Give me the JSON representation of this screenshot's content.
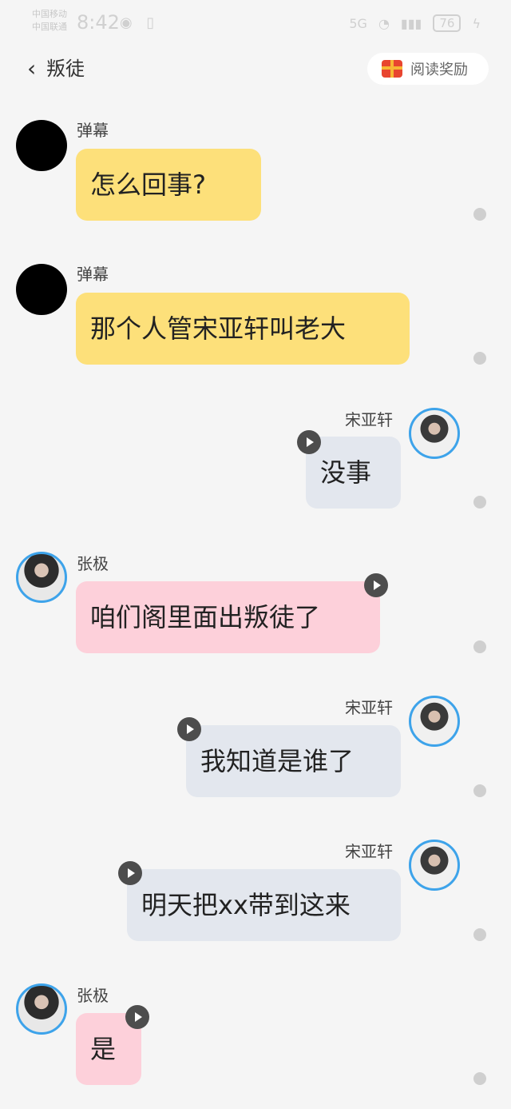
{
  "status_bar": {
    "carrier_1": "中国移动",
    "carrier_2": "中国联通",
    "time": "8:42",
    "icons": "◉ ▯",
    "network": "5G",
    "battery": "76"
  },
  "header": {
    "back_icon": "‹",
    "title": "叛徒",
    "reward_label": "阅读奖励"
  },
  "messages": [
    {
      "name": "弹幕",
      "text": "怎么回事?"
    },
    {
      "name": "弹幕",
      "text": "那个人管宋亚轩叫老大"
    },
    {
      "name": "宋亚轩",
      "text": "没事"
    },
    {
      "name": "张极",
      "text": "咱们阁里面出叛徒了"
    },
    {
      "name": "宋亚轩",
      "text": "我知道是谁了"
    },
    {
      "name": "宋亚轩",
      "text": "明天把xx带到这来"
    },
    {
      "name": "张极",
      "text": "是"
    }
  ]
}
